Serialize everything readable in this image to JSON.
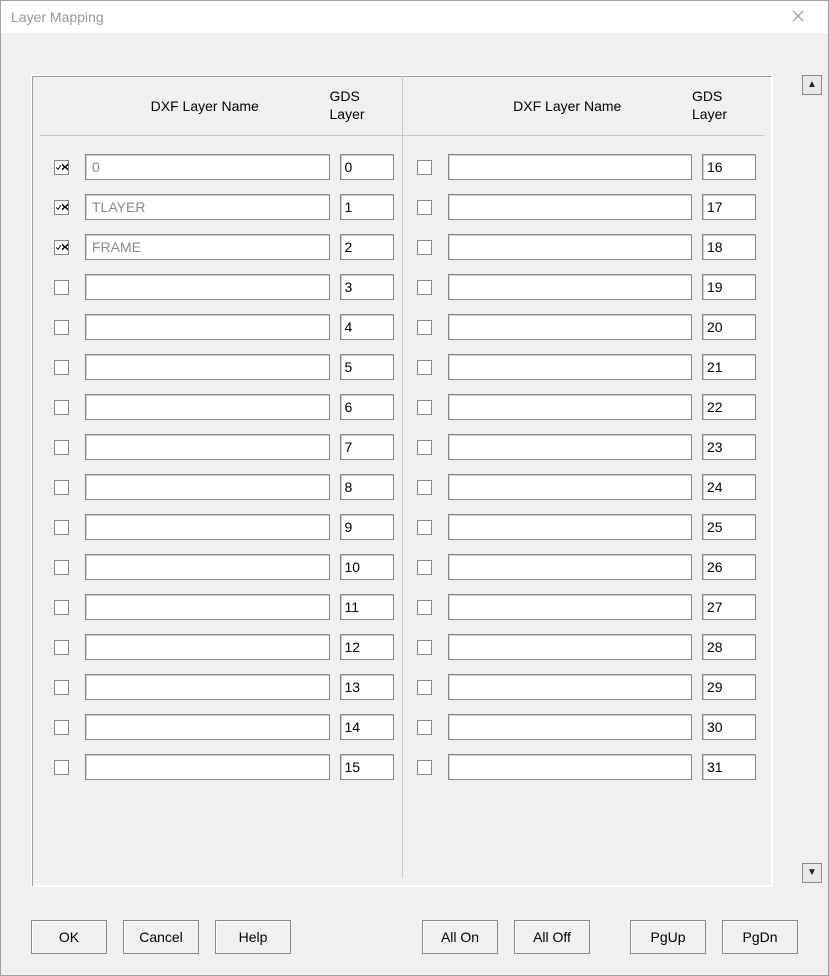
{
  "window": {
    "title": "Layer Mapping"
  },
  "headers": {
    "dxf": "DXF Layer Name",
    "gds": "GDS Layer"
  },
  "left_rows": [
    {
      "checked": true,
      "name": "0",
      "gds": "0",
      "readonly": true
    },
    {
      "checked": true,
      "name": "TLAYER",
      "gds": "1",
      "readonly": true
    },
    {
      "checked": true,
      "name": "FRAME",
      "gds": "2",
      "readonly": true
    },
    {
      "checked": false,
      "name": "",
      "gds": "3",
      "readonly": false
    },
    {
      "checked": false,
      "name": "",
      "gds": "4",
      "readonly": false
    },
    {
      "checked": false,
      "name": "",
      "gds": "5",
      "readonly": false
    },
    {
      "checked": false,
      "name": "",
      "gds": "6",
      "readonly": false
    },
    {
      "checked": false,
      "name": "",
      "gds": "7",
      "readonly": false
    },
    {
      "checked": false,
      "name": "",
      "gds": "8",
      "readonly": false
    },
    {
      "checked": false,
      "name": "",
      "gds": "9",
      "readonly": false
    },
    {
      "checked": false,
      "name": "",
      "gds": "10",
      "readonly": false
    },
    {
      "checked": false,
      "name": "",
      "gds": "11",
      "readonly": false
    },
    {
      "checked": false,
      "name": "",
      "gds": "12",
      "readonly": false
    },
    {
      "checked": false,
      "name": "",
      "gds": "13",
      "readonly": false
    },
    {
      "checked": false,
      "name": "",
      "gds": "14",
      "readonly": false
    },
    {
      "checked": false,
      "name": "",
      "gds": "15",
      "readonly": false
    }
  ],
  "right_rows": [
    {
      "checked": false,
      "name": "",
      "gds": "16"
    },
    {
      "checked": false,
      "name": "",
      "gds": "17"
    },
    {
      "checked": false,
      "name": "",
      "gds": "18"
    },
    {
      "checked": false,
      "name": "",
      "gds": "19"
    },
    {
      "checked": false,
      "name": "",
      "gds": "20"
    },
    {
      "checked": false,
      "name": "",
      "gds": "21"
    },
    {
      "checked": false,
      "name": "",
      "gds": "22"
    },
    {
      "checked": false,
      "name": "",
      "gds": "23"
    },
    {
      "checked": false,
      "name": "",
      "gds": "24"
    },
    {
      "checked": false,
      "name": "",
      "gds": "25"
    },
    {
      "checked": false,
      "name": "",
      "gds": "26"
    },
    {
      "checked": false,
      "name": "",
      "gds": "27"
    },
    {
      "checked": false,
      "name": "",
      "gds": "28"
    },
    {
      "checked": false,
      "name": "",
      "gds": "29"
    },
    {
      "checked": false,
      "name": "",
      "gds": "30"
    },
    {
      "checked": false,
      "name": "",
      "gds": "31"
    }
  ],
  "buttons": {
    "ok": "OK",
    "cancel": "Cancel",
    "help": "Help",
    "all_on": "All On",
    "all_off": "All Off",
    "pgup": "PgUp",
    "pgdn": "PgDn"
  }
}
